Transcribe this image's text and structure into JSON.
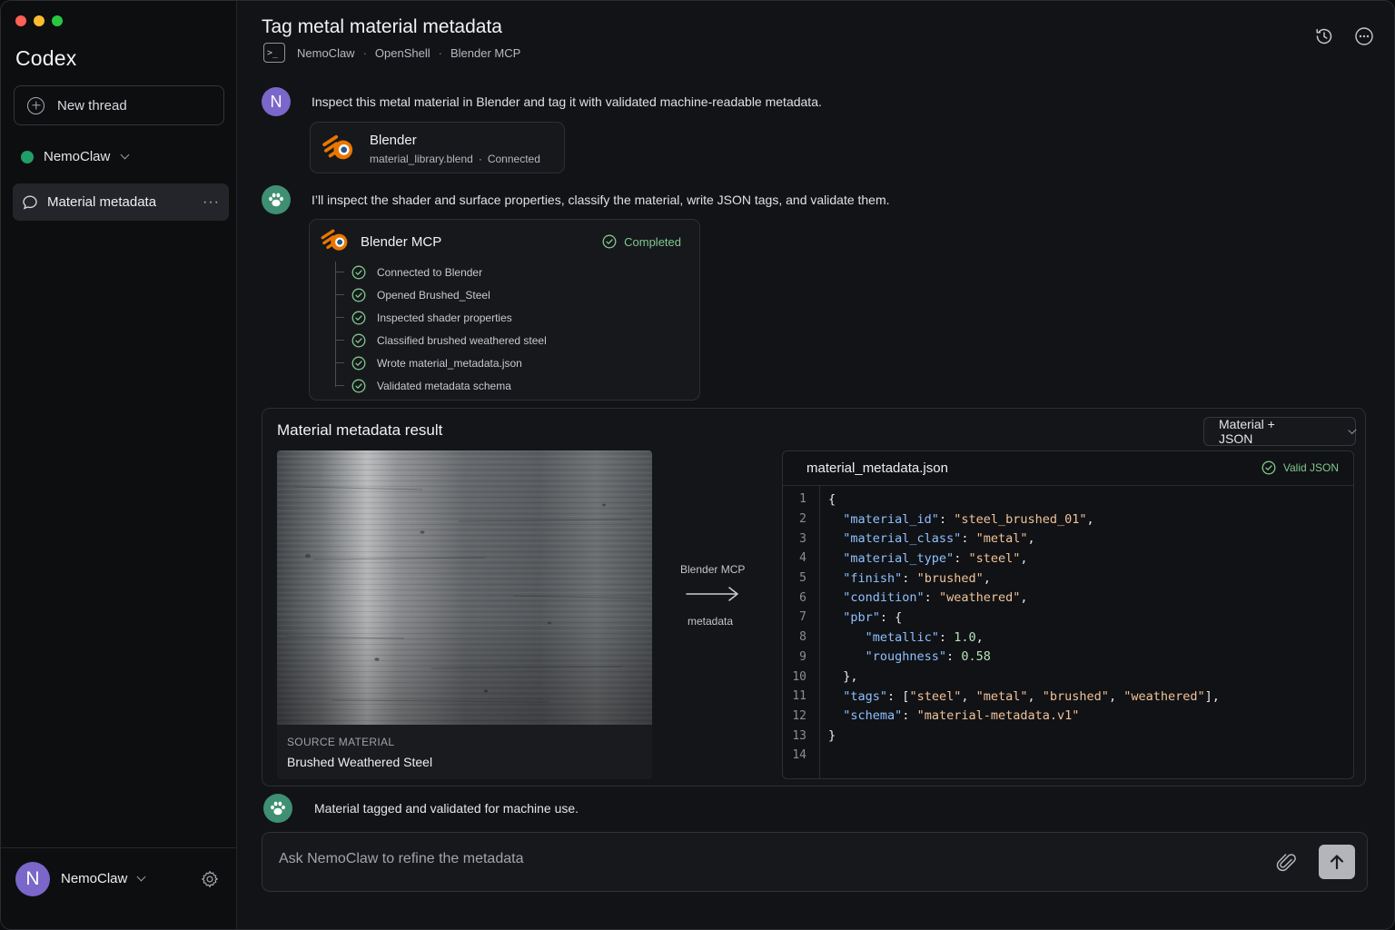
{
  "sidebar": {
    "app_name": "Codex",
    "new_thread_label": "New thread",
    "workspace_name": "NemoClaw",
    "thread_label": "Material metadata",
    "thread_more": "···",
    "footer_user": "NemoClaw",
    "footer_initial": "N"
  },
  "header": {
    "title": "Tag metal material metadata",
    "terminal_glyph": ">_",
    "breadcrumbs": [
      "NemoClaw",
      "OpenShell",
      "Blender MCP"
    ],
    "separator": "·"
  },
  "messages": {
    "user_initial": "N",
    "user_text": "Inspect this metal material in Blender and tag it with validated machine-readable metadata.",
    "blender_card": {
      "title": "Blender",
      "file": "material_library.blend",
      "sep": "·",
      "status": "Connected"
    },
    "assistant_text": "I’ll inspect the shader and surface properties, classify the material, write JSON tags, and validate them.",
    "mcp": {
      "title": "Blender MCP",
      "status": "Completed",
      "steps": [
        "Connected to Blender",
        "Opened Brushed_Steel",
        "Inspected shader properties",
        "Classified brushed weathered steel",
        "Wrote material_metadata.json",
        "Validated metadata schema"
      ]
    },
    "final_text": "Material tagged and validated for machine use."
  },
  "result": {
    "title": "Material metadata result",
    "view_select": "Material + JSON",
    "source_label": "SOURCE MATERIAL",
    "source_name": "Brushed Weathered Steel",
    "arrow_top": "Blender MCP",
    "arrow_bottom": "metadata",
    "json_filename": "material_metadata.json",
    "json_status": "Valid JSON",
    "code_lines": [
      [
        {
          "t": "p",
          "v": "{"
        }
      ],
      [
        {
          "t": "p",
          "v": "  "
        },
        {
          "t": "k",
          "v": "\"material_id\""
        },
        {
          "t": "p",
          "v": ": "
        },
        {
          "t": "s",
          "v": "\"steel_brushed_01\""
        },
        {
          "t": "p",
          "v": ","
        }
      ],
      [
        {
          "t": "p",
          "v": "  "
        },
        {
          "t": "k",
          "v": "\"material_class\""
        },
        {
          "t": "p",
          "v": ": "
        },
        {
          "t": "s",
          "v": "\"metal\""
        },
        {
          "t": "p",
          "v": ","
        }
      ],
      [
        {
          "t": "p",
          "v": "  "
        },
        {
          "t": "k",
          "v": "\"material_type\""
        },
        {
          "t": "p",
          "v": ": "
        },
        {
          "t": "s",
          "v": "\"steel\""
        },
        {
          "t": "p",
          "v": ","
        }
      ],
      [
        {
          "t": "p",
          "v": "  "
        },
        {
          "t": "k",
          "v": "\"finish\""
        },
        {
          "t": "p",
          "v": ": "
        },
        {
          "t": "s",
          "v": "\"brushed\""
        },
        {
          "t": "p",
          "v": ","
        }
      ],
      [
        {
          "t": "p",
          "v": "  "
        },
        {
          "t": "k",
          "v": "\"condition\""
        },
        {
          "t": "p",
          "v": ": "
        },
        {
          "t": "s",
          "v": "\"weathered\""
        },
        {
          "t": "p",
          "v": ","
        }
      ],
      [
        {
          "t": "p",
          "v": "  "
        },
        {
          "t": "k",
          "v": "\"pbr\""
        },
        {
          "t": "p",
          "v": ": {"
        }
      ],
      [
        {
          "t": "p",
          "v": "     "
        },
        {
          "t": "k",
          "v": "\"metallic\""
        },
        {
          "t": "p",
          "v": ": "
        },
        {
          "t": "n",
          "v": "1.0"
        },
        {
          "t": "p",
          "v": ","
        }
      ],
      [
        {
          "t": "p",
          "v": "     "
        },
        {
          "t": "k",
          "v": "\"roughness\""
        },
        {
          "t": "p",
          "v": ": "
        },
        {
          "t": "n",
          "v": "0.58"
        }
      ],
      [
        {
          "t": "p",
          "v": "  },"
        }
      ],
      [
        {
          "t": "p",
          "v": "  "
        },
        {
          "t": "k",
          "v": "\"tags\""
        },
        {
          "t": "p",
          "v": ": ["
        },
        {
          "t": "s",
          "v": "\"steel\""
        },
        {
          "t": "p",
          "v": ", "
        },
        {
          "t": "s",
          "v": "\"metal\""
        },
        {
          "t": "p",
          "v": ", "
        },
        {
          "t": "s",
          "v": "\"brushed\""
        },
        {
          "t": "p",
          "v": ", "
        },
        {
          "t": "s",
          "v": "\"weathered\""
        },
        {
          "t": "p",
          "v": "],"
        }
      ],
      [
        {
          "t": "p",
          "v": "  "
        },
        {
          "t": "k",
          "v": "\"schema\""
        },
        {
          "t": "p",
          "v": ": "
        },
        {
          "t": "s",
          "v": "\"material-metadata.v1\""
        }
      ],
      [
        {
          "t": "p",
          "v": "}"
        }
      ],
      []
    ]
  },
  "composer": {
    "placeholder": "Ask NemoClaw to refine the metadata"
  },
  "colors": {
    "accent_green": "#7fc88e",
    "avatar_purple": "#7a67c9",
    "bot_green": "#3f8f73",
    "blender_orange": "#ea7600"
  }
}
